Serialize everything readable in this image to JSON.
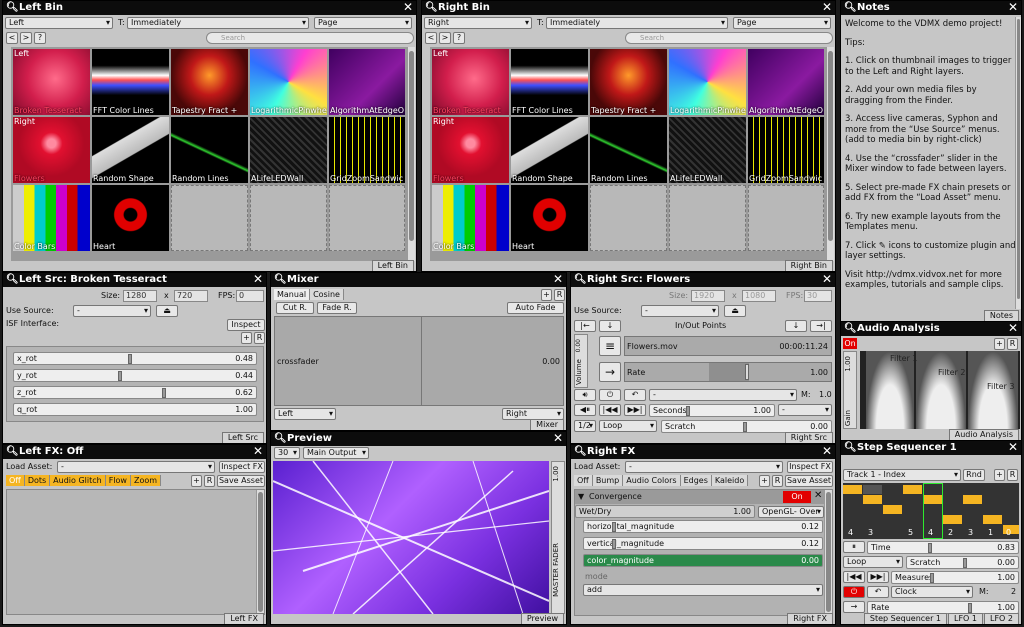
{
  "left_bin": {
    "title": "Left Bin",
    "target": "Left",
    "trigger_label": "T:",
    "trigger_mode": "Immediately",
    "page_mode": "Page",
    "nav_prev": "<",
    "nav_next": ">",
    "nav_help": "?",
    "search_placeholder": "Search",
    "footer": "Left Bin",
    "layer_label_top": "Left",
    "layer_label_mid": "Right",
    "clips": [
      "Broken Tesseract",
      "FFT Color Lines",
      "Tapestry Fract +",
      "LogarithmicPinwhe",
      "AlgorithmAtEdgeO",
      "Flowers",
      "Random Shape",
      "Random Lines",
      "ALifeLEDWall",
      "GridZoomSandwic",
      "Color Bars",
      "Heart"
    ]
  },
  "right_bin": {
    "title": "Right Bin",
    "target": "Right",
    "trigger_label": "T:",
    "trigger_mode": "Immediately",
    "page_mode": "Page",
    "nav_prev": "<",
    "nav_next": ">",
    "nav_help": "?",
    "search_placeholder": "Search",
    "footer": "Right Bin",
    "layer_label_top": "Left",
    "layer_label_mid": "Right",
    "clips": [
      "Broken Tesseract",
      "FFT Color Lines",
      "Tapestry Fract +",
      "LogarithmicPinwhe",
      "AlgorithmAtEdgeO",
      "Flowers",
      "Random Shape",
      "Random Lines",
      "ALifeLEDWall",
      "GridZoomSandwic",
      "Color Bars",
      "Heart"
    ]
  },
  "notes": {
    "title": "Notes",
    "footer": "Notes",
    "lines": [
      "Welcome to the VDMX demo project!",
      "Tips:",
      "1. Click on thumbnail images to trigger to the Left and Right layers.",
      "2. Add your own media files by dragging from the Finder.",
      "3. Access live cameras, Syphon and more from the “Use Source” menus. (add to media bin by right-click)",
      "4. Use the “crossfader” slider in the Mixer window to fade between layers.",
      "5. Select pre-made FX chain presets or add FX from the “Load Asset” menu.",
      "6. Try new example layouts from the Templates menu.",
      "7. Click ✎ icons to customize plugin and layer settings.",
      "Visit http://vdmx.vidvox.net for more examples, tutorials and sample clips."
    ]
  },
  "left_src": {
    "title": "Left Src: Broken Tesseract",
    "size_label": "Size:",
    "width": "1280",
    "x": "x",
    "height": "720",
    "fps_label": "FPS:",
    "fps": "0",
    "use_source_label": "Use Source:",
    "use_source": "-",
    "eject": "⏏",
    "isf_label": "ISF Interface:",
    "inspect": "Inspect",
    "plus": "+",
    "r": "R",
    "params": [
      {
        "name": "x_rot",
        "value": "0.48",
        "level": 0.48
      },
      {
        "name": "y_rot",
        "value": "0.44",
        "level": 0.44
      },
      {
        "name": "z_rot",
        "value": "0.62",
        "level": 0.62
      },
      {
        "name": "q_rot",
        "value": "1.00",
        "level": 1.0
      }
    ],
    "footer": "Left Src"
  },
  "mixer": {
    "title": "Mixer",
    "tab_manual": "Manual",
    "tab_cosine": "Cosine",
    "plus": "+",
    "r": "R",
    "cut_r": "Cut R.",
    "fade_r": "Fade R.",
    "auto_fade": "Auto Fade",
    "crossfader_label": "crossfader",
    "crossfader_value": "0.00",
    "left_select": "Left",
    "right_select": "Right",
    "footer": "Mixer"
  },
  "right_src": {
    "title": "Right Src: Flowers",
    "size_label": "Size:",
    "width": "1920",
    "x": "x",
    "height": "1080",
    "fps_label": "FPS:",
    "fps": "30",
    "use_source_label": "Use Source:",
    "use_source": "-",
    "eject": "⏏",
    "inout_label": "In/Out Points",
    "volume_label": "Volume",
    "volume_value": "0.00",
    "file_name": "Flowers.mov",
    "file_time": "00:00:11.24",
    "rate_label": "Rate",
    "rate_value": "1.00",
    "m_label": "M:",
    "m_value": "1.0",
    "seconds_label": "Seconds",
    "seconds_value": "1.00",
    "loop": "Loop",
    "scratch_label": "Scratch",
    "scratch_value": "0.00",
    "half": "1/2",
    "dash": "-",
    "footer": "Right Src"
  },
  "audio": {
    "title": "Audio Analysis",
    "on": "On",
    "level": "1.00",
    "gain": "Gain",
    "plus": "+",
    "r": "R",
    "filters": [
      "Filter 1",
      "Filter 2",
      "Filter 3"
    ],
    "footer": "Audio Analysis"
  },
  "left_fx": {
    "title": "Left FX: Off",
    "load_label": "Load Asset:",
    "load_value": "-",
    "inspect": "Inspect FX",
    "plus": "+",
    "r": "R",
    "save": "Save Asset",
    "tabs": [
      "Off",
      "Dots",
      "Audio Glitch",
      "Flow",
      "Zoom"
    ],
    "footer": "Left FX"
  },
  "preview": {
    "title": "Preview",
    "fps": "30",
    "output": "Main Output",
    "master_value": "1.00",
    "master_label": "MASTER FADER",
    "footer": "Preview"
  },
  "right_fx": {
    "title": "Right FX",
    "load_label": "Load Asset:",
    "load_value": "-",
    "inspect": "Inspect FX",
    "plus": "+",
    "r": "R",
    "save": "Save Asset",
    "tabs": [
      "Off",
      "Bump",
      "Audio Colors",
      "Edges",
      "Kaleido"
    ],
    "effect_name": "Convergence",
    "on": "On",
    "wetdry_label": "Wet/Dry",
    "wetdry_value": "1.00",
    "blend": "OpenGL- Over",
    "params": [
      {
        "name": "horizontal_magnitude",
        "value": "0.12"
      },
      {
        "name": "vertical_magnitude",
        "value": "0.12"
      },
      {
        "name": "color_magnitude",
        "value": "0.00"
      }
    ],
    "mode_label": "mode",
    "mode_value": "add",
    "footer": "Right FX"
  },
  "sequencer": {
    "title": "Step Sequencer 1",
    "track": "Track 1 - Index",
    "rnd": "Rnd",
    "plus": "+",
    "r": "R",
    "col_numbers": [
      "4",
      "3",
      "5",
      "4",
      "2",
      "3",
      "1",
      "0"
    ],
    "time_label": "Time",
    "time_value": "0.83",
    "loop": "Loop",
    "scratch_label": "Scratch",
    "scratch_value": "0.00",
    "measures_label": "Measures",
    "measures_value": "1.00",
    "clock": "Clock",
    "m_label": "M:",
    "m_value": "2",
    "rate_label": "Rate",
    "rate_value": "1.00",
    "footer_tabs": [
      "Step Sequencer 1",
      "LFO 1",
      "LFO 2"
    ]
  },
  "colors": {
    "accent_orange": "#f5b522",
    "on_red": "#e20000",
    "selected_green": "#2a8a4a",
    "title_bar": "#0c0c0c",
    "panel": "#c6c6c6"
  }
}
